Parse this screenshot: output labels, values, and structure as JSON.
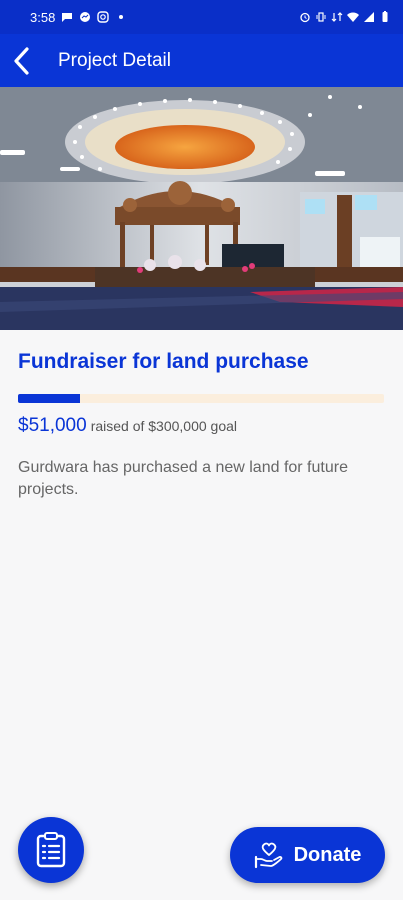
{
  "status_bar": {
    "time": "3:58",
    "left_icons": [
      "chat-bubble-icon",
      "messenger-icon",
      "instagram-icon",
      "dot-icon"
    ],
    "right_icons": [
      "alarm-icon",
      "vibrate-icon",
      "data-icon",
      "wifi-icon",
      "signal-icon",
      "battery-icon"
    ]
  },
  "app_bar": {
    "title": "Project Detail",
    "back_icon": "chevron-left-icon"
  },
  "project": {
    "title": "Fundraiser for land purchase",
    "raised_amount": "$51,000",
    "goal_text": "raised of $300,000 goal",
    "progress_fraction": 0.17,
    "description": "Gurdwara has purchased a new land for future projects."
  },
  "actions": {
    "clipboard_icon": "clipboard-list-icon",
    "donate_label": "Donate",
    "donate_icon": "hand-heart-icon"
  },
  "colors": {
    "primary": "#0a35d6",
    "status_bar": "#0a2fc8",
    "progress_track": "#fbeedd",
    "background": "#f7f7f8"
  }
}
